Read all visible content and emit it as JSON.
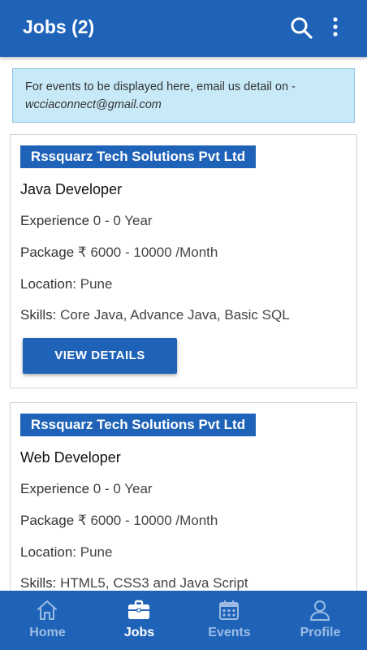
{
  "header": {
    "title": "Jobs (2)"
  },
  "notice": {
    "text": "For events to be displayed here, email us detail on -",
    "email": "wcciaconnect@gmail.com"
  },
  "jobs": [
    {
      "company": "Rssquarz Tech Solutions Pvt Ltd",
      "title": "Java Developer",
      "experience_label": "Experience",
      "experience": "0 - 0 Year",
      "package_label": "Package",
      "package": "₹ 6000 - 10000 /Month",
      "location_label": "Location:",
      "location": "Pune",
      "skills_label": "Skills:",
      "skills": "Core Java, Advance Java, Basic SQL",
      "button": "VIEW DETAILS"
    },
    {
      "company": "Rssquarz Tech Solutions Pvt Ltd",
      "title": "Web Developer",
      "experience_label": "Experience",
      "experience": "0 - 0 Year",
      "package_label": "Package",
      "package": "₹ 6000 - 10000 /Month",
      "location_label": "Location:",
      "location": "Pune",
      "skills_label": "Skills:",
      "skills": "HTML5, CSS3 and Java Script"
    }
  ],
  "nav": [
    {
      "label": "Home",
      "icon": "home-icon",
      "active": false
    },
    {
      "label": "Jobs",
      "icon": "briefcase-icon",
      "active": true
    },
    {
      "label": "Events",
      "icon": "calendar-icon",
      "active": false
    },
    {
      "label": "Profile",
      "icon": "person-icon",
      "active": false
    }
  ],
  "colors": {
    "primary": "#1f63b8",
    "notice_bg": "#c8e9f7",
    "nav_inactive": "#9bbbe3"
  }
}
